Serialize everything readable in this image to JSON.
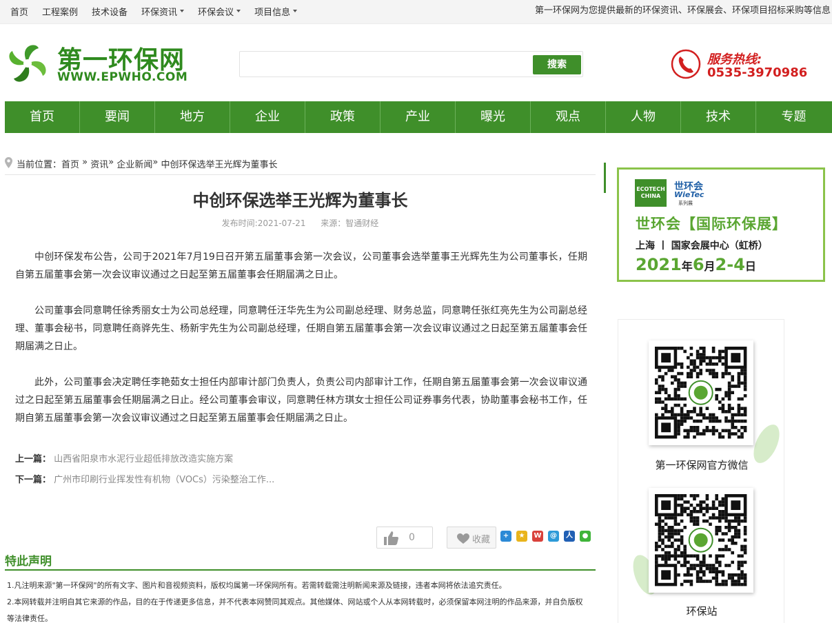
{
  "topbar": {
    "links": [
      {
        "label": "首页",
        "dropdown": false
      },
      {
        "label": "工程案例",
        "dropdown": false
      },
      {
        "label": "技术设备",
        "dropdown": false
      },
      {
        "label": "环保资讯",
        "dropdown": true
      },
      {
        "label": "环保会议",
        "dropdown": true
      },
      {
        "label": "项目信息",
        "dropdown": true
      }
    ],
    "slogan": "第一环保网为您提供最新的环保资讯、环保展会、环保项目招标采购等信息"
  },
  "logo": {
    "title": "第一环保网",
    "url": "WWW.EPWHO.COM"
  },
  "search": {
    "placeholder": "",
    "button": "搜索"
  },
  "hotline": {
    "label": "服务热线:",
    "number": "0535-3970986"
  },
  "nav": [
    "首页",
    "要闻",
    "地方",
    "企业",
    "政策",
    "产业",
    "曝光",
    "观点",
    "人物",
    "技术",
    "专题"
  ],
  "breadcrumb": {
    "prefix": "当前位置：",
    "home": "首页",
    "sep1": " » ",
    "cat": "资讯",
    "sep2": "» ",
    "sub": "企业新闻",
    "sep3": "» ",
    "current": "中创环保选举王光辉为董事长"
  },
  "article": {
    "title": "中创环保选举王光辉为董事长",
    "publish_time": "发布时间:2021-07-21",
    "source": "来源：智通财经",
    "paragraphs": [
      "中创环保发布公告，公司于2021年7月19日召开第五届董事会第一次会议，公司董事会选举董事王光辉先生为公司董事长，任期自第五届董事会第一次会议审议通过之日起至第五届董事会任期届满之日止。",
      "公司董事会同意聘任徐秀丽女士为公司总经理，同意聘任汪华先生为公司副总经理、财务总监，同意聘任张红亮先生为公司副总经理、董事会秘书，同意聘任商骅先生、杨新宇先生为公司副总经理，任期自第五届董事会第一次会议审议通过之日起至第五届董事会任期届满之日止。",
      "此外，公司董事会决定聘任李艳茹女士担任内部审计部门负责人，负责公司内部审计工作，任期自第五届董事会第一次会议审议通过之日起至第五届董事会任期届满之日止。经公司董事会审议，同意聘任林方琪女士担任公司证券事务代表，协助董事会秘书工作，任期自第五届董事会第一次会议审议通过之日起至第五届董事会任期届满之日止。"
    ],
    "prev_label": "上一篇：",
    "prev_title": "山西省阳泉市水泥行业超低排放改造实施方案",
    "next_label": "下一篇：",
    "next_title": "广州市印刷行业挥发性有机物（VOCs）污染整治工作..."
  },
  "actions": {
    "like_count": "0",
    "fav_label": "收藏"
  },
  "statement": {
    "title": "特此声明",
    "lines": [
      "1.凡注明来源\"第一环保网\"的所有文字、图片和音视频资料，版权均属第一环保网所有。若需转载需注明新闻来源及链接，违者本网将依法追究责任。",
      "2.本网转载并注明自其它来源的作品，目的在于传递更多信息，并不代表本网赞同其观点。其他媒体、网站或个人从本网转载时，必须保留本网注明的作品来源，并自负版权等法律责任。"
    ]
  },
  "ad": {
    "eco_badge": "ECOTECH CHINA",
    "brand_cn": "世环会",
    "brand_en": "WieTec",
    "series": "系列展",
    "headline": "世环会【国际环保展】",
    "location": "上海 丨 国家会展中心（虹桥）",
    "date_year": "2021",
    "date_y_unit": "年",
    "date_month": "6",
    "date_m_unit": "月",
    "date_days": "2-4",
    "date_d_unit": "日"
  },
  "sidebar": {
    "qr1_caption": "第一环保网官方微信",
    "qr2_caption": "环保站"
  },
  "colors": {
    "brand_green": "#3f8f2a",
    "hotline_red": "#d21f1f",
    "ad_border": "#8bc34a"
  }
}
